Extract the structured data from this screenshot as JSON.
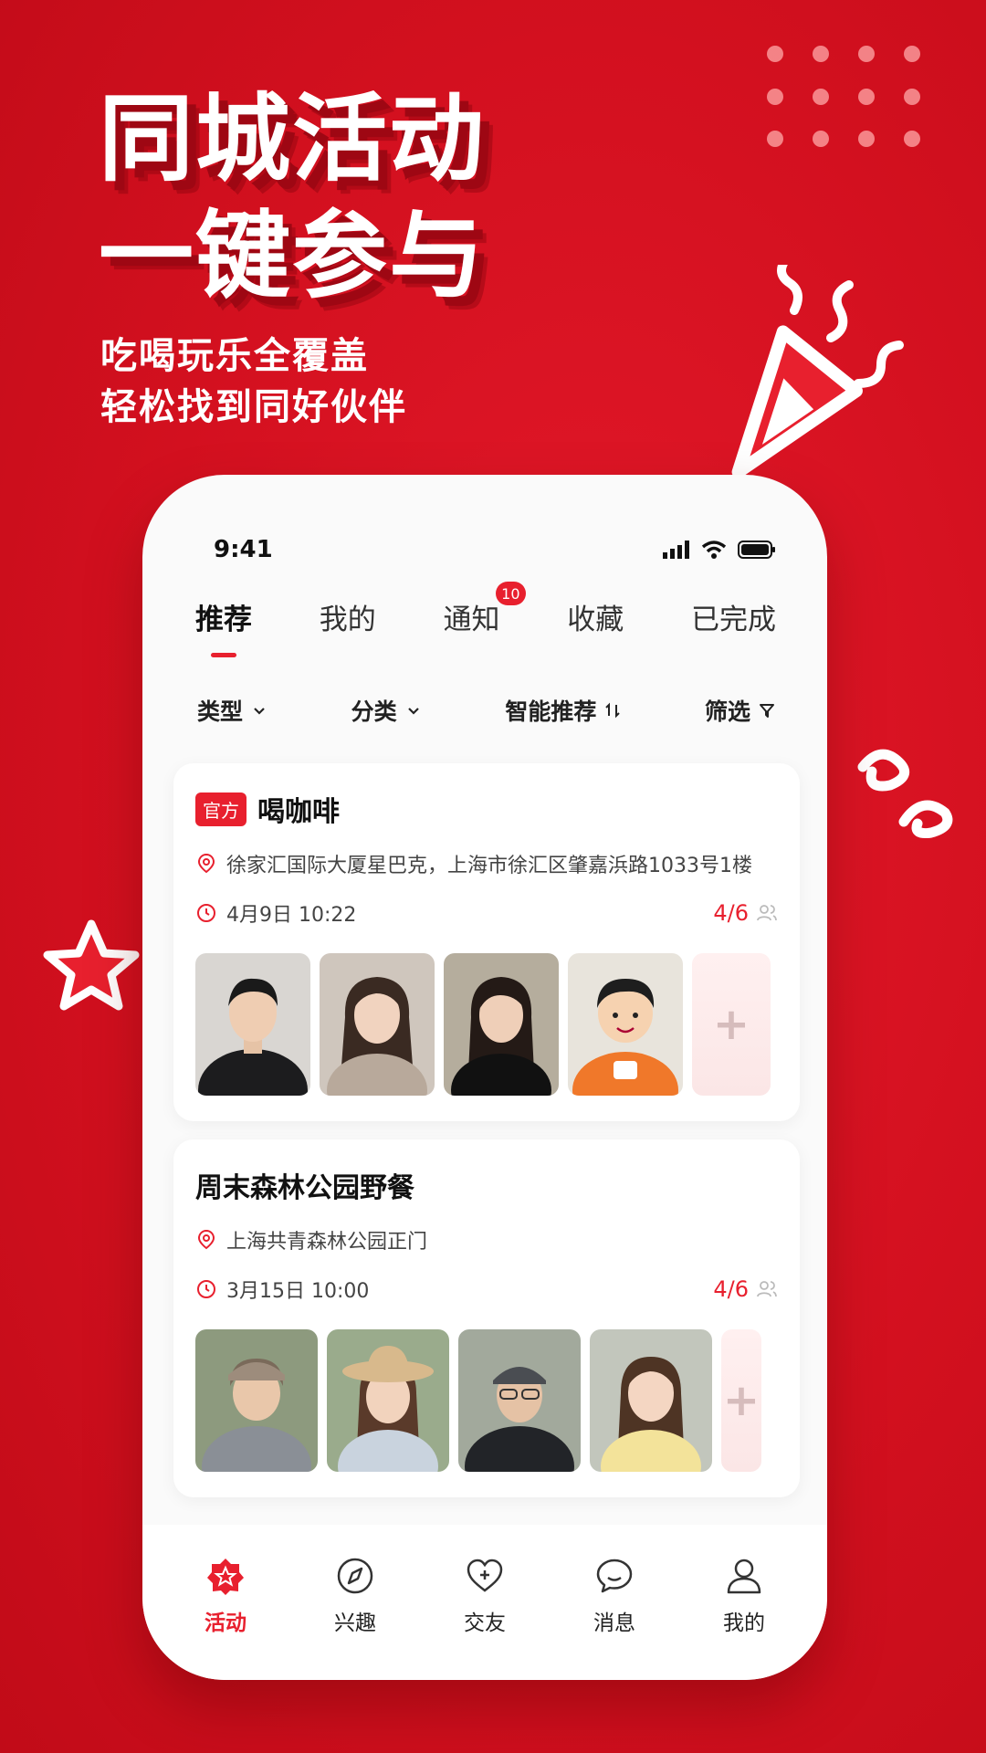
{
  "promo": {
    "headline_1": "同城活动",
    "headline_2": "一键参与",
    "sub_1": "吃喝玩乐全覆盖",
    "sub_2": "轻松找到同好伙伴"
  },
  "status_bar": {
    "time": "9:41"
  },
  "tabs": [
    {
      "label": "推荐",
      "active": true
    },
    {
      "label": "我的"
    },
    {
      "label": "通知",
      "badge": "10"
    },
    {
      "label": "收藏"
    },
    {
      "label": "已完成"
    }
  ],
  "filters": [
    {
      "label": "类型",
      "icon": "chevron-down-icon"
    },
    {
      "label": "分类",
      "icon": "chevron-down-icon"
    },
    {
      "label": "智能推荐",
      "icon": "sort-icon"
    },
    {
      "label": "筛选",
      "icon": "funnel-icon"
    }
  ],
  "activities": [
    {
      "tag": "官方",
      "title": "喝咖啡",
      "location": "徐家汇国际大厦星巴克，上海市徐汇区肇嘉浜路1033号1楼",
      "time": "4月9日 10:22",
      "count": "4/6"
    },
    {
      "title": "周末森林公园野餐",
      "location": "上海共青森林公园正门",
      "time": "3月15日 10:00",
      "count": "4/6"
    }
  ],
  "bottom_nav": [
    {
      "label": "活动",
      "icon": "activity-star-icon",
      "active": true
    },
    {
      "label": "兴趣",
      "icon": "compass-icon"
    },
    {
      "label": "交友",
      "icon": "heart-icon"
    },
    {
      "label": "消息",
      "icon": "chat-bubble-icon"
    },
    {
      "label": "我的",
      "icon": "person-icon"
    }
  ],
  "colors": {
    "brand_red": "#e8202e",
    "background_red": "#d3101f"
  }
}
